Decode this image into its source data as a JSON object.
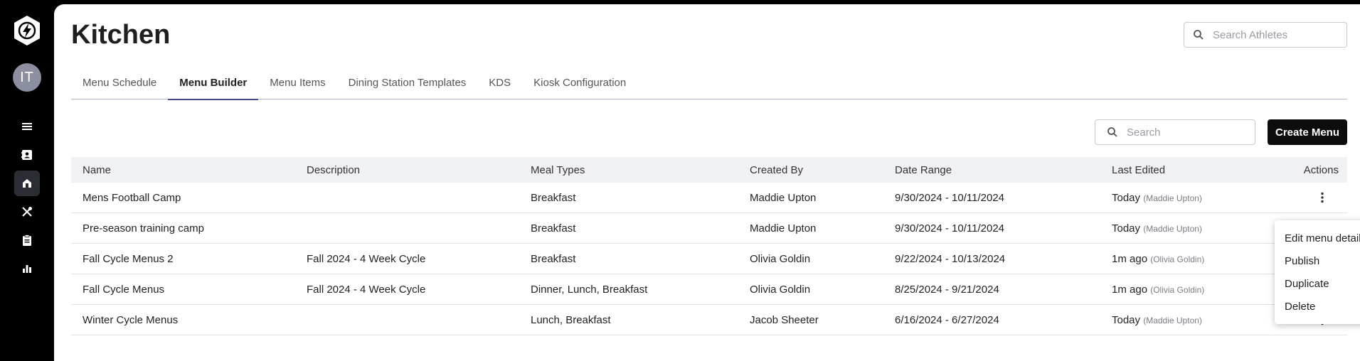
{
  "sidebar": {
    "logo_icon": "bolt-logo-icon",
    "avatar_initials": "IT",
    "nav": [
      {
        "name": "menu-lines-icon",
        "active": false
      },
      {
        "name": "contact-card-icon",
        "active": false
      },
      {
        "name": "kitchen-icon",
        "active": true
      },
      {
        "name": "utensils-icon",
        "active": false
      },
      {
        "name": "clipboard-icon",
        "active": false
      },
      {
        "name": "bar-chart-icon",
        "active": false
      }
    ]
  },
  "header": {
    "title": "Kitchen",
    "athlete_search_placeholder": "Search Athletes"
  },
  "tabs": [
    {
      "label": "Menu Schedule",
      "active": false
    },
    {
      "label": "Menu Builder",
      "active": true
    },
    {
      "label": "Menu Items",
      "active": false
    },
    {
      "label": "Dining Station Templates",
      "active": false
    },
    {
      "label": "KDS",
      "active": false
    },
    {
      "label": "Kiosk Configuration",
      "active": false
    }
  ],
  "toolbar": {
    "search_placeholder": "Search",
    "create_label": "Create Menu"
  },
  "table": {
    "columns": [
      "Name",
      "Description",
      "Meal Types",
      "Created By",
      "Date Range",
      "Last Edited",
      "Actions"
    ],
    "rows": [
      {
        "name": "Mens Football Camp",
        "description": "",
        "meal_types": "Breakfast",
        "created_by": "Maddie Upton",
        "date_range": "9/30/2024 - 10/11/2024",
        "last_edited": "Today",
        "editor": "(Maddie Upton)"
      },
      {
        "name": "Pre-season training camp",
        "description": "",
        "meal_types": "Breakfast",
        "created_by": "Maddie Upton",
        "date_range": "9/30/2024 - 10/11/2024",
        "last_edited": "Today",
        "editor": "(Maddie Upton)"
      },
      {
        "name": "Fall Cycle Menus 2",
        "description": "Fall 2024 - 4 Week Cycle",
        "meal_types": "Breakfast",
        "created_by": "Olivia Goldin",
        "date_range": "9/22/2024 - 10/13/2024",
        "last_edited": "1m ago",
        "editor": "(Olivia Goldin)"
      },
      {
        "name": "Fall Cycle Menus",
        "description": "Fall 2024 - 4 Week Cycle",
        "meal_types": "Dinner, Lunch, Breakfast",
        "created_by": "Olivia Goldin",
        "date_range": "8/25/2024 - 9/21/2024",
        "last_edited": "1m ago",
        "editor": "(Olivia Goldin)"
      },
      {
        "name": "Winter Cycle Menus",
        "description": "",
        "meal_types": "Lunch, Breakfast",
        "created_by": "Jacob Sheeter",
        "date_range": "6/16/2024 - 6/27/2024",
        "last_edited": "Today",
        "editor": "(Maddie Upton)"
      }
    ]
  },
  "context_menu": {
    "items": [
      "Edit menu details",
      "Publish",
      "Duplicate",
      "Delete"
    ]
  }
}
